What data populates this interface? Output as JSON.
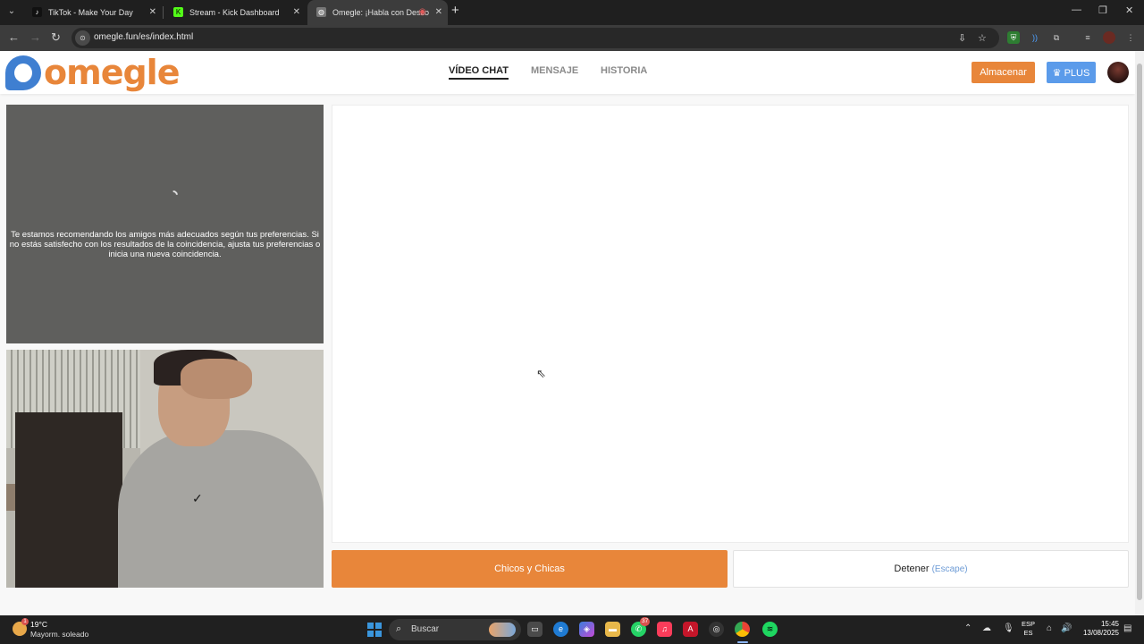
{
  "browser": {
    "tabs": [
      {
        "title": "TikTok - Make Your Day",
        "icon": "tiktok-icon"
      },
      {
        "title": "Stream - Kick Dashboard",
        "icon": "kick-icon"
      },
      {
        "title": "Omegle: ¡Habla con Desco",
        "icon": "globe-icon",
        "active": true
      }
    ],
    "url": "omegle.fun/es/index.html",
    "extension_badge": "2"
  },
  "site": {
    "logo_text": "omegle",
    "nav": [
      "VÍDEO CHAT",
      "MENSAJE",
      "HISTORIA"
    ],
    "store_label": "Almacenar",
    "plus_label": "PLUS",
    "plus_icon": "crown-icon"
  },
  "remote": {
    "message": "Te estamos recomendando los amigos más adecuados según tus preferencias. Si no estás satisfecho con los resultados de la coincidencia, ajusta tus preferencias o inicia una nueva coincidencia."
  },
  "controls": {
    "start_label": "Chicos y Chicas",
    "stop_label": "Detener",
    "stop_hint": "(Escape)"
  },
  "taskbar": {
    "weather_temp": "19°C",
    "weather_desc": "Mayorm. soleado",
    "weather_badge": "1",
    "search_label": "Buscar",
    "whatsapp_badge": "37",
    "lang_top": "ESP",
    "lang_bottom": "ES",
    "time": "15:45",
    "date": "13/08/2025"
  },
  "colors": {
    "accent_orange": "#e8863a",
    "plus_blue": "#5b9bea",
    "remote_bg": "#5f5f5d"
  }
}
